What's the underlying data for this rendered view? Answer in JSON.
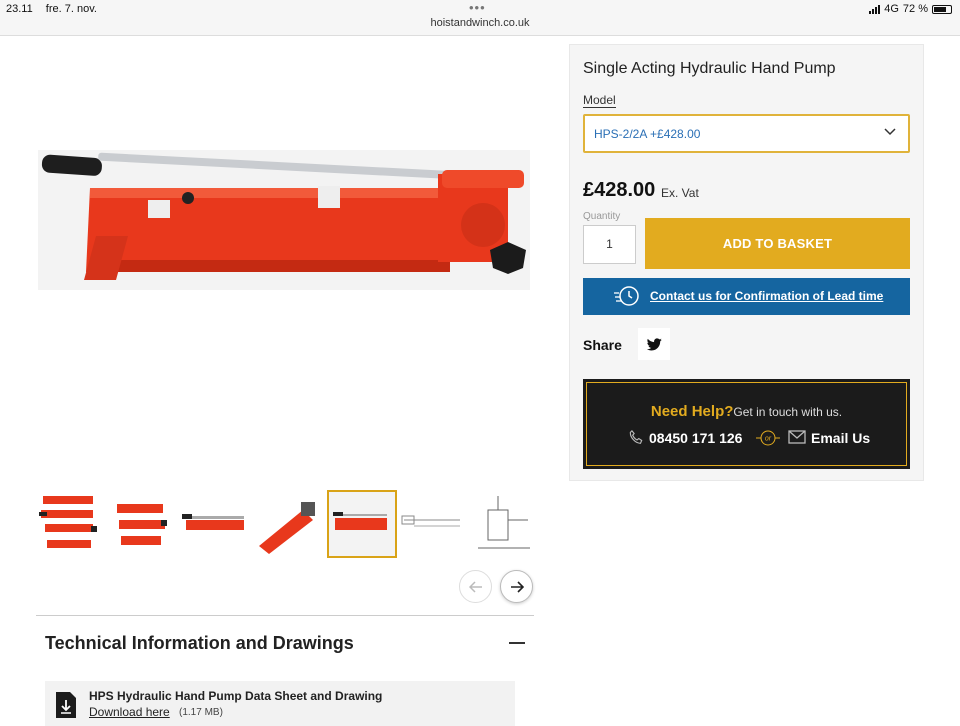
{
  "status_bar": {
    "time": "23.11",
    "date": "fre. 7. nov.",
    "url": "hoistandwinch.co.uk",
    "network": "4G",
    "battery": "72 %",
    "battery_level": 0.72
  },
  "product": {
    "title": "Single Acting Hydraulic Hand Pump",
    "model_label": "Model",
    "model_value": "HPS-2/2A +£428.00",
    "price": "£428.00",
    "price_suffix": "Ex. Vat",
    "quantity_label": "Quantity",
    "quantity": "1",
    "add_to_basket": "ADD TO BASKET",
    "contact_link": "Contact us for Confirmation of Lead time",
    "share_label": "Share"
  },
  "help": {
    "heading": "Need Help?",
    "subtext": "Get in touch with us.",
    "phone": "08450 171 126",
    "or": "or",
    "email": "Email Us"
  },
  "gallery": {
    "selected_index": 4,
    "thumbnail_count": 7
  },
  "tech": {
    "title": "Technical Information and Drawings",
    "download_title": "HPS Hydraulic Hand Pump Data Sheet and Drawing",
    "download_link": "Download here",
    "download_size": "(1.17 MB)"
  },
  "colors": {
    "accent": "#e2ab1f",
    "contact_blue": "#1565a0",
    "product_red": "#e8381c",
    "link_blue": "#2a6fb5"
  }
}
